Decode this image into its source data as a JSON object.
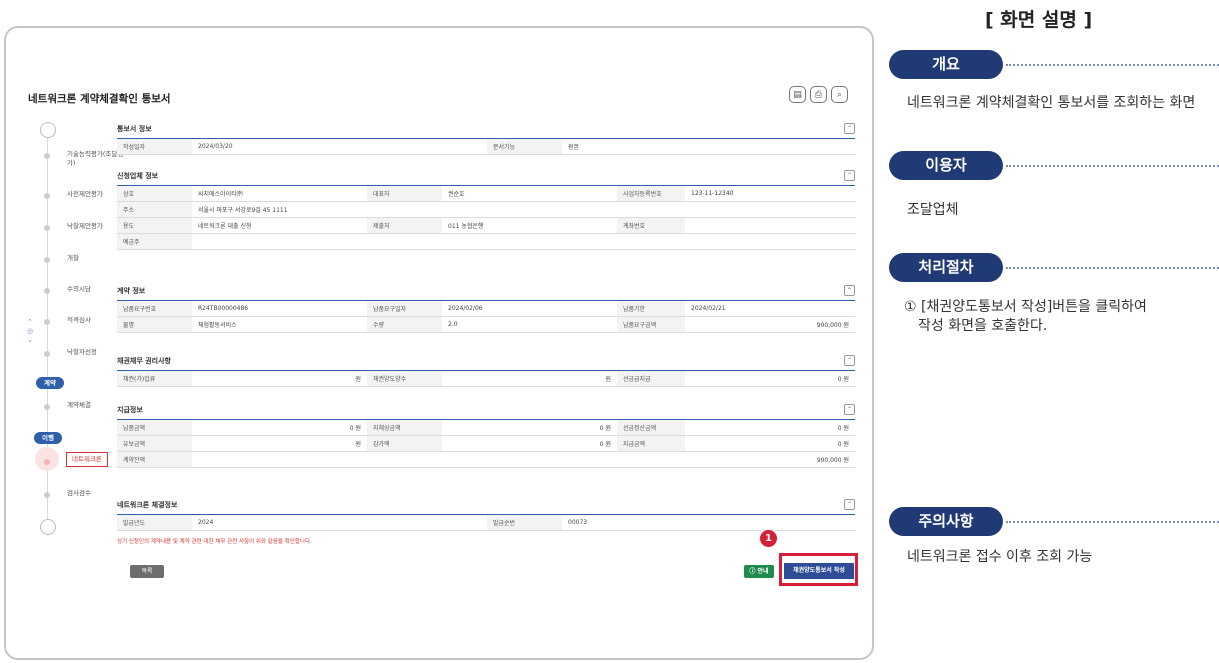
{
  "page_title": "네트워크론 계약체결확인 통보서",
  "top_icons": [
    "print-preview-icon",
    "print-icon",
    "zoom-icon"
  ],
  "steps": [
    {
      "label": "기술능력평가(조달평가)"
    },
    {
      "label": "사전제안평가"
    },
    {
      "label": "낙찰제안평가"
    },
    {
      "label": "개찰"
    },
    {
      "label": "수의시담"
    },
    {
      "label": "적격심사"
    },
    {
      "label": "낙찰자선정"
    },
    {
      "label": "계약체결"
    },
    {
      "label": "검사검수"
    }
  ],
  "phases": {
    "contract": "계약",
    "performance": "이행"
  },
  "active_step": "네트워크론",
  "sections": {
    "notice": {
      "title": "통보서 정보",
      "rows": [
        [
          "작성일자",
          "2024/03/20",
          "문서기능",
          "원본"
        ]
      ]
    },
    "company": {
      "title": "신청업체 정보",
      "rows": [
        [
          "상호",
          "씨지에스아이티㈜",
          "대표자",
          "권순호",
          "사업자등록번호",
          "123-11-12340"
        ],
        [
          "주소",
          "서울시 마포구 서강로9길 45 1111",
          "",
          "",
          "",
          ""
        ],
        [
          "용도",
          "네트워크론 대출 신청",
          "제출처",
          "011 농협은행",
          "계좌번호",
          ""
        ],
        [
          "예금주",
          "",
          "",
          "",
          "",
          ""
        ]
      ]
    },
    "contract": {
      "title": "계약 정보",
      "rows": [
        [
          "납품요구번호",
          "R24TB00000486",
          "납품요구일자",
          "2024/02/06",
          "납품기한",
          "2024/02/21"
        ],
        [
          "물명",
          "체험활동서비스",
          "수량",
          "2.0",
          "납품요구금액",
          "900,000 원"
        ]
      ]
    },
    "rights": {
      "title": "채권채무 권리사항",
      "rows": [
        [
          "채권(가)압류",
          "원",
          "채권양도양수",
          "원",
          "선금급지급",
          "0 원"
        ]
      ]
    },
    "payment": {
      "title": "지급정보",
      "rows": [
        [
          "납품금액",
          "0 원",
          "지체상금액",
          "0 원",
          "선금정산금액",
          "0 원"
        ],
        [
          "유보금액",
          "원",
          "감가액",
          "0 원",
          "지급금액",
          "0 원"
        ],
        [
          "계약잔액",
          "",
          "",
          "",
          "",
          "900,000 원"
        ]
      ]
    },
    "loan": {
      "title": "네트워크론 체결정보",
      "rows": [
        [
          "발급년도",
          "2024",
          "발급순번",
          "00073"
        ]
      ],
      "note": "상기 신청인의 계약내용 및 계약 관련 대한 채무 관련 사항이 위와 같음을 확인합니다."
    }
  },
  "buttons": {
    "list": "목록",
    "help": "ⓘ 안내",
    "write": "채권양도통보서 작성",
    "badge": "1"
  },
  "description": {
    "title": "[ 화면 설명 ]",
    "overview_label": "개요",
    "overview_text": "네트워크론 계약체결확인 통보서를 조회하는 화면",
    "user_label": "이용자",
    "user_text": "조달업체",
    "process_label": "처리절차",
    "process_text_1": "① [채권양도통보서 작성]버튼을 클릭하여",
    "process_text_2": "작성 화면을 호출한다.",
    "caution_label": "주의사항",
    "caution_text": "네트워크론 접수 이후 조회 가능"
  }
}
